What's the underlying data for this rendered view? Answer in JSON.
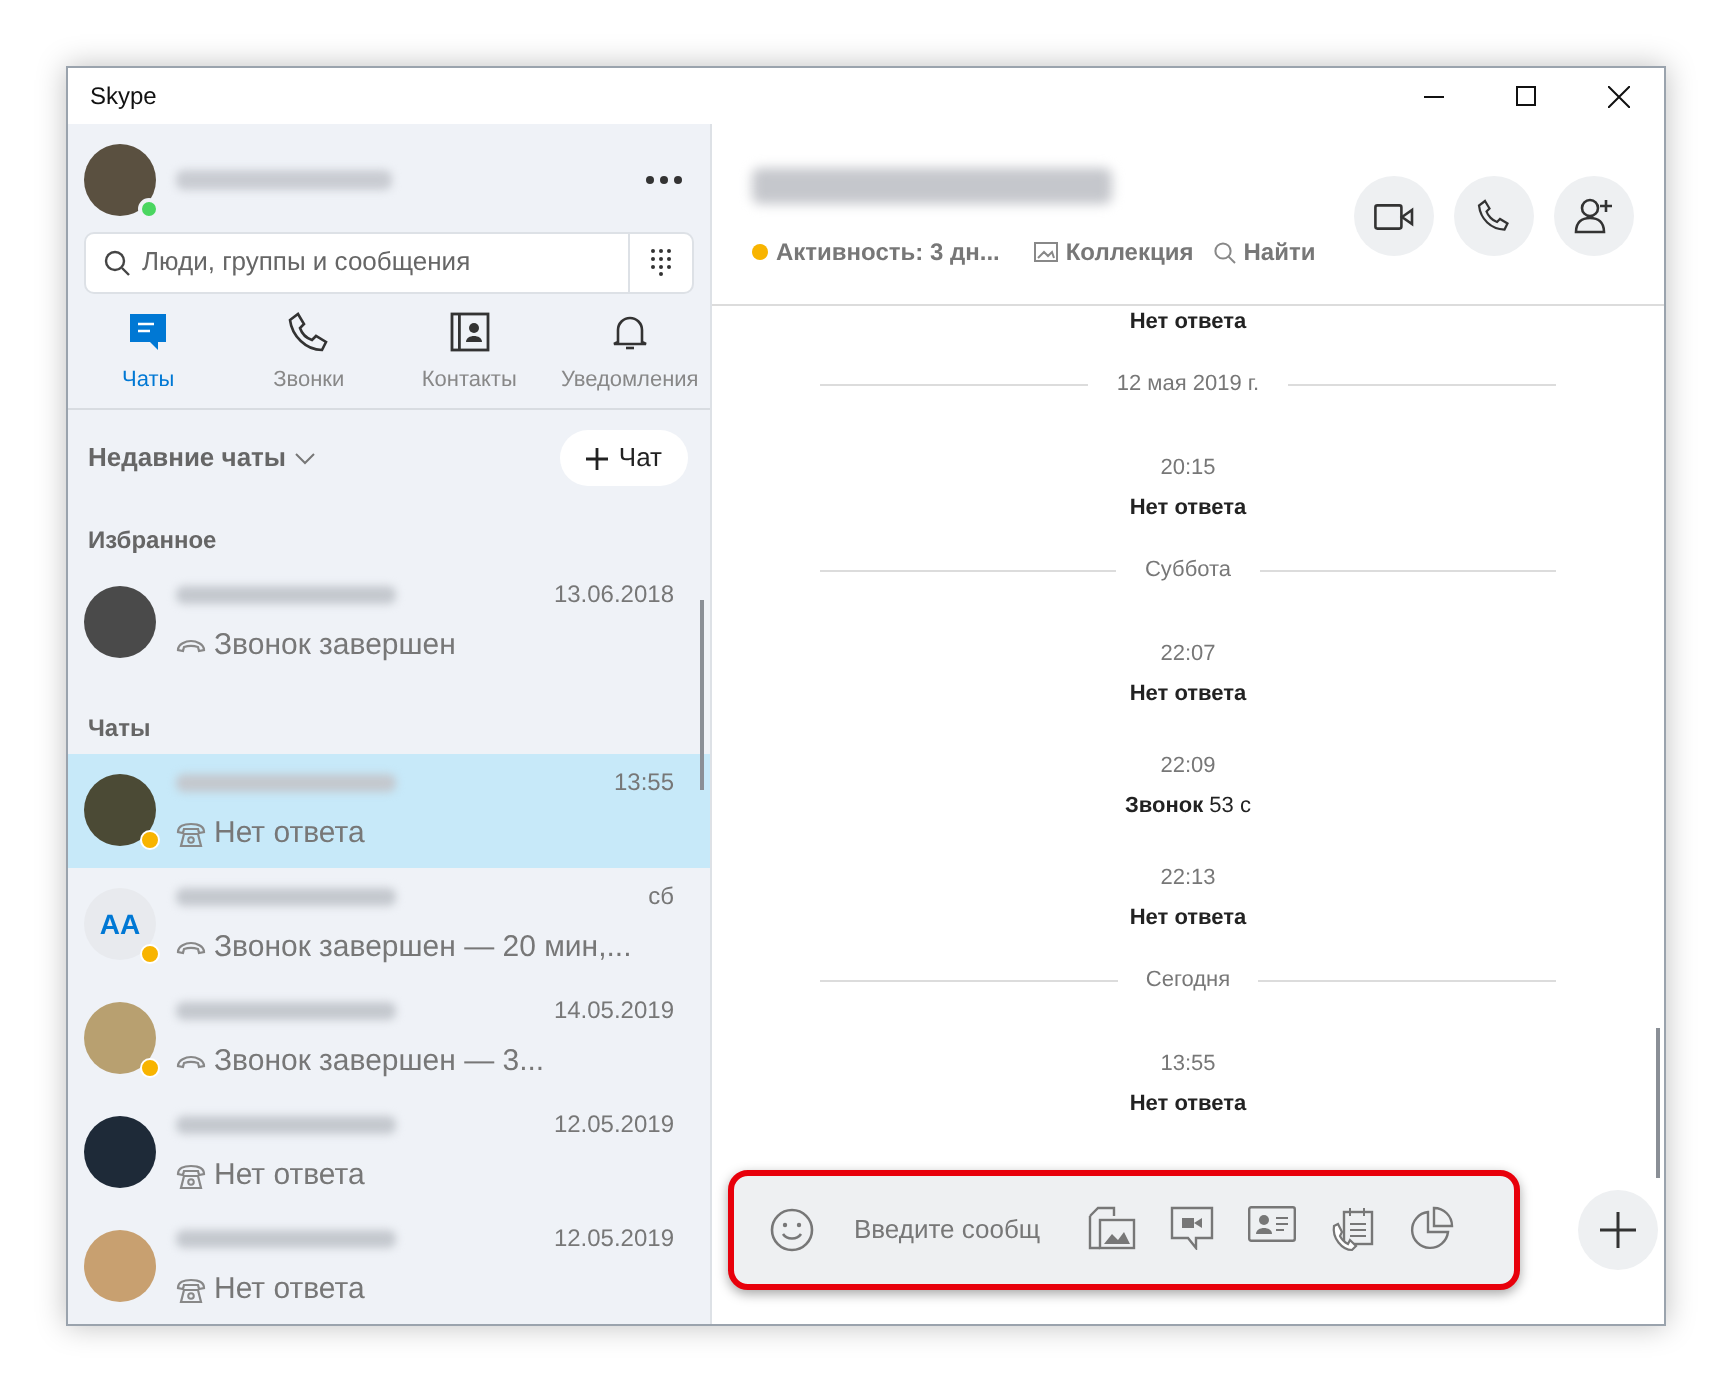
{
  "window": {
    "title": "Skype"
  },
  "profile": {
    "online": true
  },
  "search": {
    "placeholder": "Люди, группы и сообщения"
  },
  "tabs": [
    {
      "label": "Чаты",
      "kind": "chat",
      "selected": true
    },
    {
      "label": "Звонки",
      "kind": "phone",
      "selected": false
    },
    {
      "label": "Контакты",
      "kind": "contacts",
      "selected": false
    },
    {
      "label": "Уведомления",
      "kind": "bell",
      "selected": false
    }
  ],
  "recent_header": "Недавние чаты",
  "new_chat_button": "Чат",
  "sections": [
    {
      "title": "Избранное",
      "chats": [
        {
          "time": "13.06.2018",
          "preview": "Звонок завершен",
          "kind": "ended",
          "away": false,
          "selected": false
        }
      ]
    },
    {
      "title": "Чаты",
      "chats": [
        {
          "time": "13:55",
          "preview": "Нет ответа",
          "kind": "missed",
          "away": true,
          "selected": true
        },
        {
          "time": "сб",
          "preview": "Звонок завершен — 20 мин,...",
          "kind": "ended",
          "away": true,
          "selected": false,
          "initials": "AA"
        },
        {
          "time": "14.05.2019",
          "preview": "Звонок завершен — 3...",
          "kind": "ended",
          "away": true,
          "selected": false
        },
        {
          "time": "12.05.2019",
          "preview": "Нет ответа",
          "kind": "missed",
          "away": false,
          "selected": false
        },
        {
          "time": "12.05.2019",
          "preview": "Нет ответа",
          "kind": "missed",
          "away": false,
          "selected": false
        }
      ]
    }
  ],
  "conversation": {
    "activity": "Активность: 3 дн...",
    "collection": "Коллекция",
    "find": "Найти",
    "messages": [
      {
        "kind": "status",
        "text": "Нет ответа"
      },
      {
        "kind": "divider",
        "text": "12 мая 2019 г."
      },
      {
        "kind": "time",
        "text": "20:15"
      },
      {
        "kind": "status",
        "text": "Нет ответа"
      },
      {
        "kind": "divider",
        "text": "Суббота"
      },
      {
        "kind": "time",
        "text": "22:07"
      },
      {
        "kind": "status",
        "text": "Нет ответа"
      },
      {
        "kind": "time",
        "text": "22:09"
      },
      {
        "kind": "status",
        "text": "**Звонок** 53 с"
      },
      {
        "kind": "time",
        "text": "22:13"
      },
      {
        "kind": "status",
        "text": "Нет ответа"
      },
      {
        "kind": "divider",
        "text": "Сегодня"
      },
      {
        "kind": "time",
        "text": "13:55"
      },
      {
        "kind": "status",
        "text": "Нет ответа"
      }
    ]
  },
  "composer": {
    "placeholder": "Введите сообщ"
  }
}
